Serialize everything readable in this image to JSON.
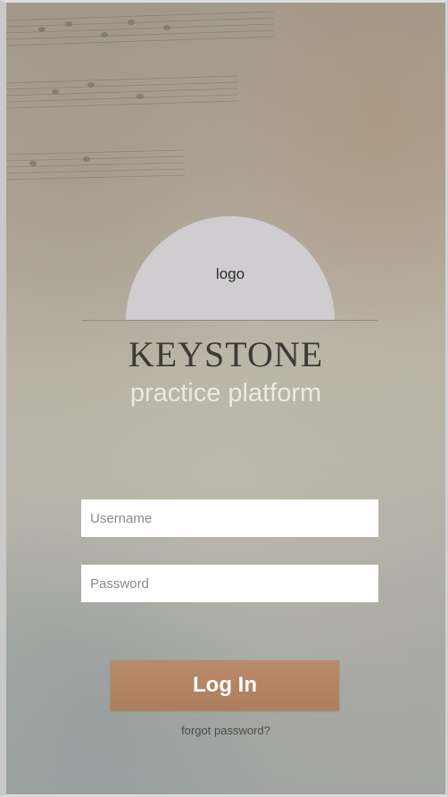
{
  "logo": {
    "label": "logo"
  },
  "brand": {
    "title": "KEYSTONE",
    "subtitle": "practice platform"
  },
  "form": {
    "username_placeholder": "Username",
    "username_value": "",
    "password_placeholder": "Password",
    "password_value": "",
    "login_label": "Log In",
    "forgot_label": "forgot password?"
  },
  "colors": {
    "button": "#b3846"
  }
}
